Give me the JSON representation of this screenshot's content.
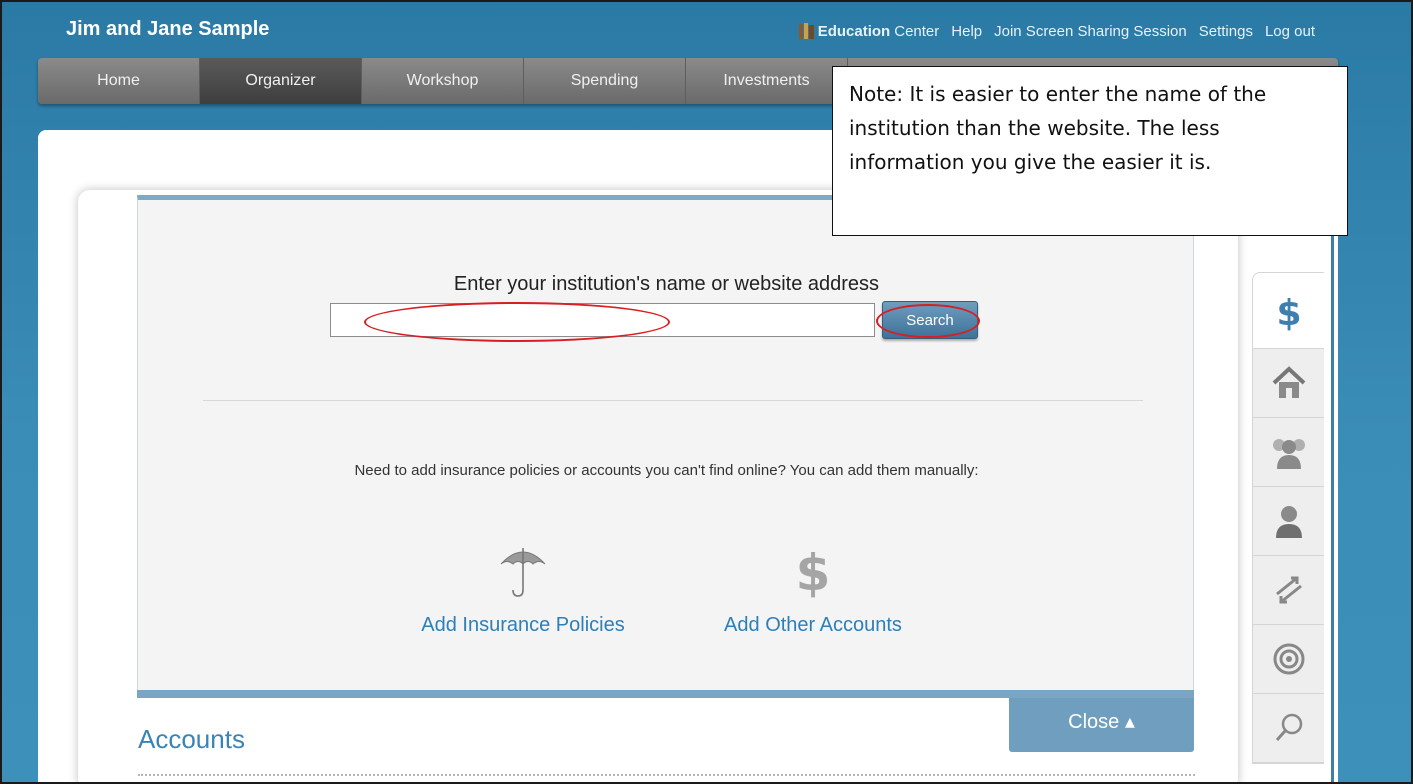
{
  "header": {
    "user_name": "Jim and Jane Sample",
    "links": {
      "education_bold": "Education",
      "education_rest": "Center",
      "help": "Help",
      "screen_sharing": "Join Screen Sharing Session",
      "settings": "Settings",
      "logout": "Log out"
    }
  },
  "nav": {
    "items": [
      "Home",
      "Organizer",
      "Workshop",
      "Spending",
      "Investments"
    ],
    "active": "Organizer"
  },
  "note": {
    "text": "Note: It is easier to enter the name of the institution than the website.  The less information you give the easier it is."
  },
  "search": {
    "title": "Enter your institution's name or website address",
    "input_value": "",
    "button_label": "Search"
  },
  "manual": {
    "text": "Need to add insurance policies or accounts you can't find online? You can add them manually:",
    "insurance_label": "Add Insurance Policies",
    "other_label": "Add Other Accounts"
  },
  "close_tab": {
    "label": "Close ▴"
  },
  "accounts": {
    "heading": "Accounts"
  },
  "side_tabs": {
    "icons": [
      "dollar-icon",
      "home-icon",
      "people-icon",
      "person-icon",
      "arrows-icon",
      "target-icon",
      "magnifier-icon"
    ]
  },
  "colors": {
    "background_blue": "#2e7fa8",
    "link_blue": "#2d7fb8",
    "annotation_red": "#d81e22",
    "panel_accent": "#7aa6c3"
  }
}
